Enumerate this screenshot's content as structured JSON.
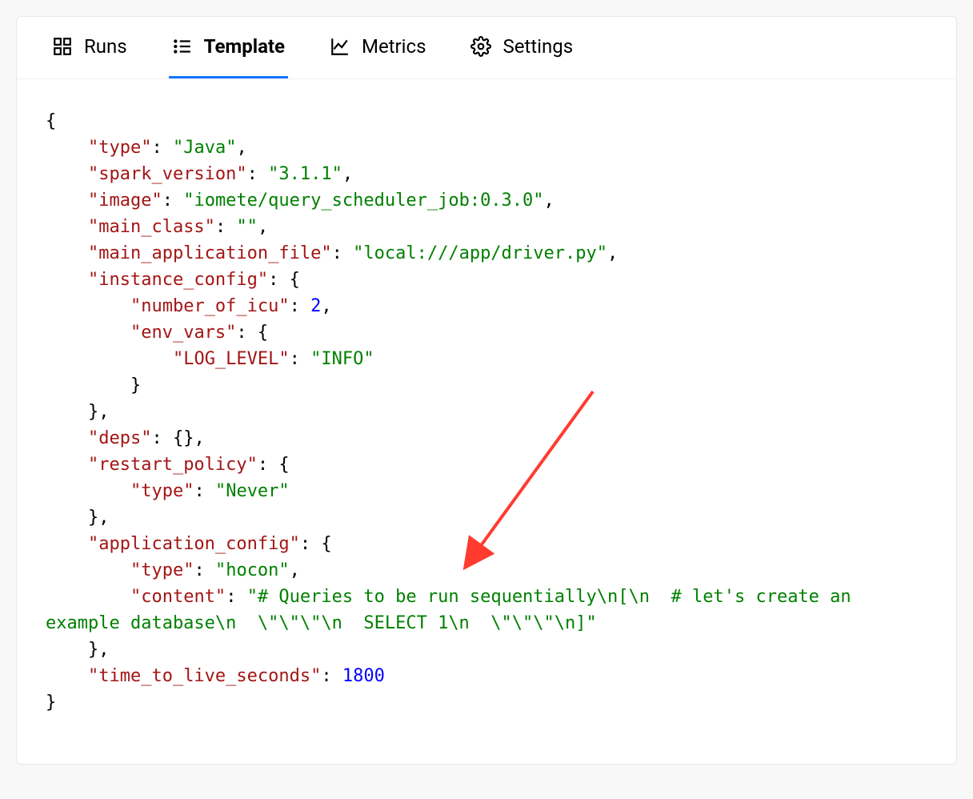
{
  "tabs": [
    {
      "label": "Runs",
      "icon": "grid"
    },
    {
      "label": "Template",
      "icon": "list",
      "active": true
    },
    {
      "label": "Metrics",
      "icon": "chart"
    },
    {
      "label": "Settings",
      "icon": "gear"
    }
  ],
  "template_json": {
    "type": "Java",
    "spark_version": "3.1.1",
    "image": "iomete/query_scheduler_job:0.3.0",
    "main_class": "",
    "main_application_file": "local:///app/driver.py",
    "instance_config": {
      "number_of_icu": 2,
      "env_vars": {
        "LOG_LEVEL": "INFO"
      }
    },
    "deps": {},
    "restart_policy": {
      "type": "Never"
    },
    "application_config": {
      "type": "hocon",
      "content": "# Queries to be run sequentially\\n[\\n  # let's create an example database\\n  \\\"\\\"\\\"\\n  SELECT 1\\n  \\\"\\\"\\\"\\n]"
    },
    "time_to_live_seconds": 1800
  },
  "code_lines": [
    [
      [
        "punc",
        "{"
      ]
    ],
    [
      [
        "punc",
        "    "
      ],
      [
        "key",
        "\"type\""
      ],
      [
        "punc",
        ": "
      ],
      [
        "str",
        "\"Java\""
      ],
      [
        "punc",
        ","
      ]
    ],
    [
      [
        "punc",
        "    "
      ],
      [
        "key",
        "\"spark_version\""
      ],
      [
        "punc",
        ": "
      ],
      [
        "str",
        "\"3.1.1\""
      ],
      [
        "punc",
        ","
      ]
    ],
    [
      [
        "punc",
        "    "
      ],
      [
        "key",
        "\"image\""
      ],
      [
        "punc",
        ": "
      ],
      [
        "str",
        "\"iomete/query_scheduler_job:0.3.0\""
      ],
      [
        "punc",
        ","
      ]
    ],
    [
      [
        "punc",
        "    "
      ],
      [
        "key",
        "\"main_class\""
      ],
      [
        "punc",
        ": "
      ],
      [
        "str",
        "\"\""
      ],
      [
        "punc",
        ","
      ]
    ],
    [
      [
        "punc",
        "    "
      ],
      [
        "key",
        "\"main_application_file\""
      ],
      [
        "punc",
        ": "
      ],
      [
        "str",
        "\"local:///app/driver.py\""
      ],
      [
        "punc",
        ","
      ]
    ],
    [
      [
        "punc",
        "    "
      ],
      [
        "key",
        "\"instance_config\""
      ],
      [
        "punc",
        ": {"
      ]
    ],
    [
      [
        "punc",
        "        "
      ],
      [
        "key",
        "\"number_of_icu\""
      ],
      [
        "punc",
        ": "
      ],
      [
        "num",
        "2"
      ],
      [
        "punc",
        ","
      ]
    ],
    [
      [
        "punc",
        "        "
      ],
      [
        "key",
        "\"env_vars\""
      ],
      [
        "punc",
        ": {"
      ]
    ],
    [
      [
        "punc",
        "            "
      ],
      [
        "key",
        "\"LOG_LEVEL\""
      ],
      [
        "punc",
        ": "
      ],
      [
        "str",
        "\"INFO\""
      ]
    ],
    [
      [
        "punc",
        "        }"
      ]
    ],
    [
      [
        "punc",
        "    },"
      ]
    ],
    [
      [
        "punc",
        "    "
      ],
      [
        "key",
        "\"deps\""
      ],
      [
        "punc",
        ": {},"
      ]
    ],
    [
      [
        "punc",
        "    "
      ],
      [
        "key",
        "\"restart_policy\""
      ],
      [
        "punc",
        ": {"
      ]
    ],
    [
      [
        "punc",
        "        "
      ],
      [
        "key",
        "\"type\""
      ],
      [
        "punc",
        ": "
      ],
      [
        "str",
        "\"Never\""
      ]
    ],
    [
      [
        "punc",
        "    },"
      ]
    ],
    [
      [
        "punc",
        "    "
      ],
      [
        "key",
        "\"application_config\""
      ],
      [
        "punc",
        ": {"
      ]
    ],
    [
      [
        "punc",
        "        "
      ],
      [
        "key",
        "\"type\""
      ],
      [
        "punc",
        ": "
      ],
      [
        "str",
        "\"hocon\""
      ],
      [
        "punc",
        ","
      ]
    ],
    [
      [
        "punc",
        "        "
      ],
      [
        "key",
        "\"content\""
      ],
      [
        "punc",
        ": "
      ],
      [
        "str",
        "\"# Queries to be run sequentially\\n[\\n  # let's create an example database\\n  \\\"\\\"\\\"\\n  SELECT 1\\n  \\\"\\\"\\\"\\n]\""
      ]
    ],
    [
      [
        "punc",
        "    },"
      ]
    ],
    [
      [
        "punc",
        "    "
      ],
      [
        "key",
        "\"time_to_live_seconds\""
      ],
      [
        "punc",
        ": "
      ],
      [
        "num",
        "1800"
      ]
    ],
    [
      [
        "punc",
        "}"
      ]
    ]
  ],
  "annotation_arrow": {
    "color": "#ff3b30"
  }
}
